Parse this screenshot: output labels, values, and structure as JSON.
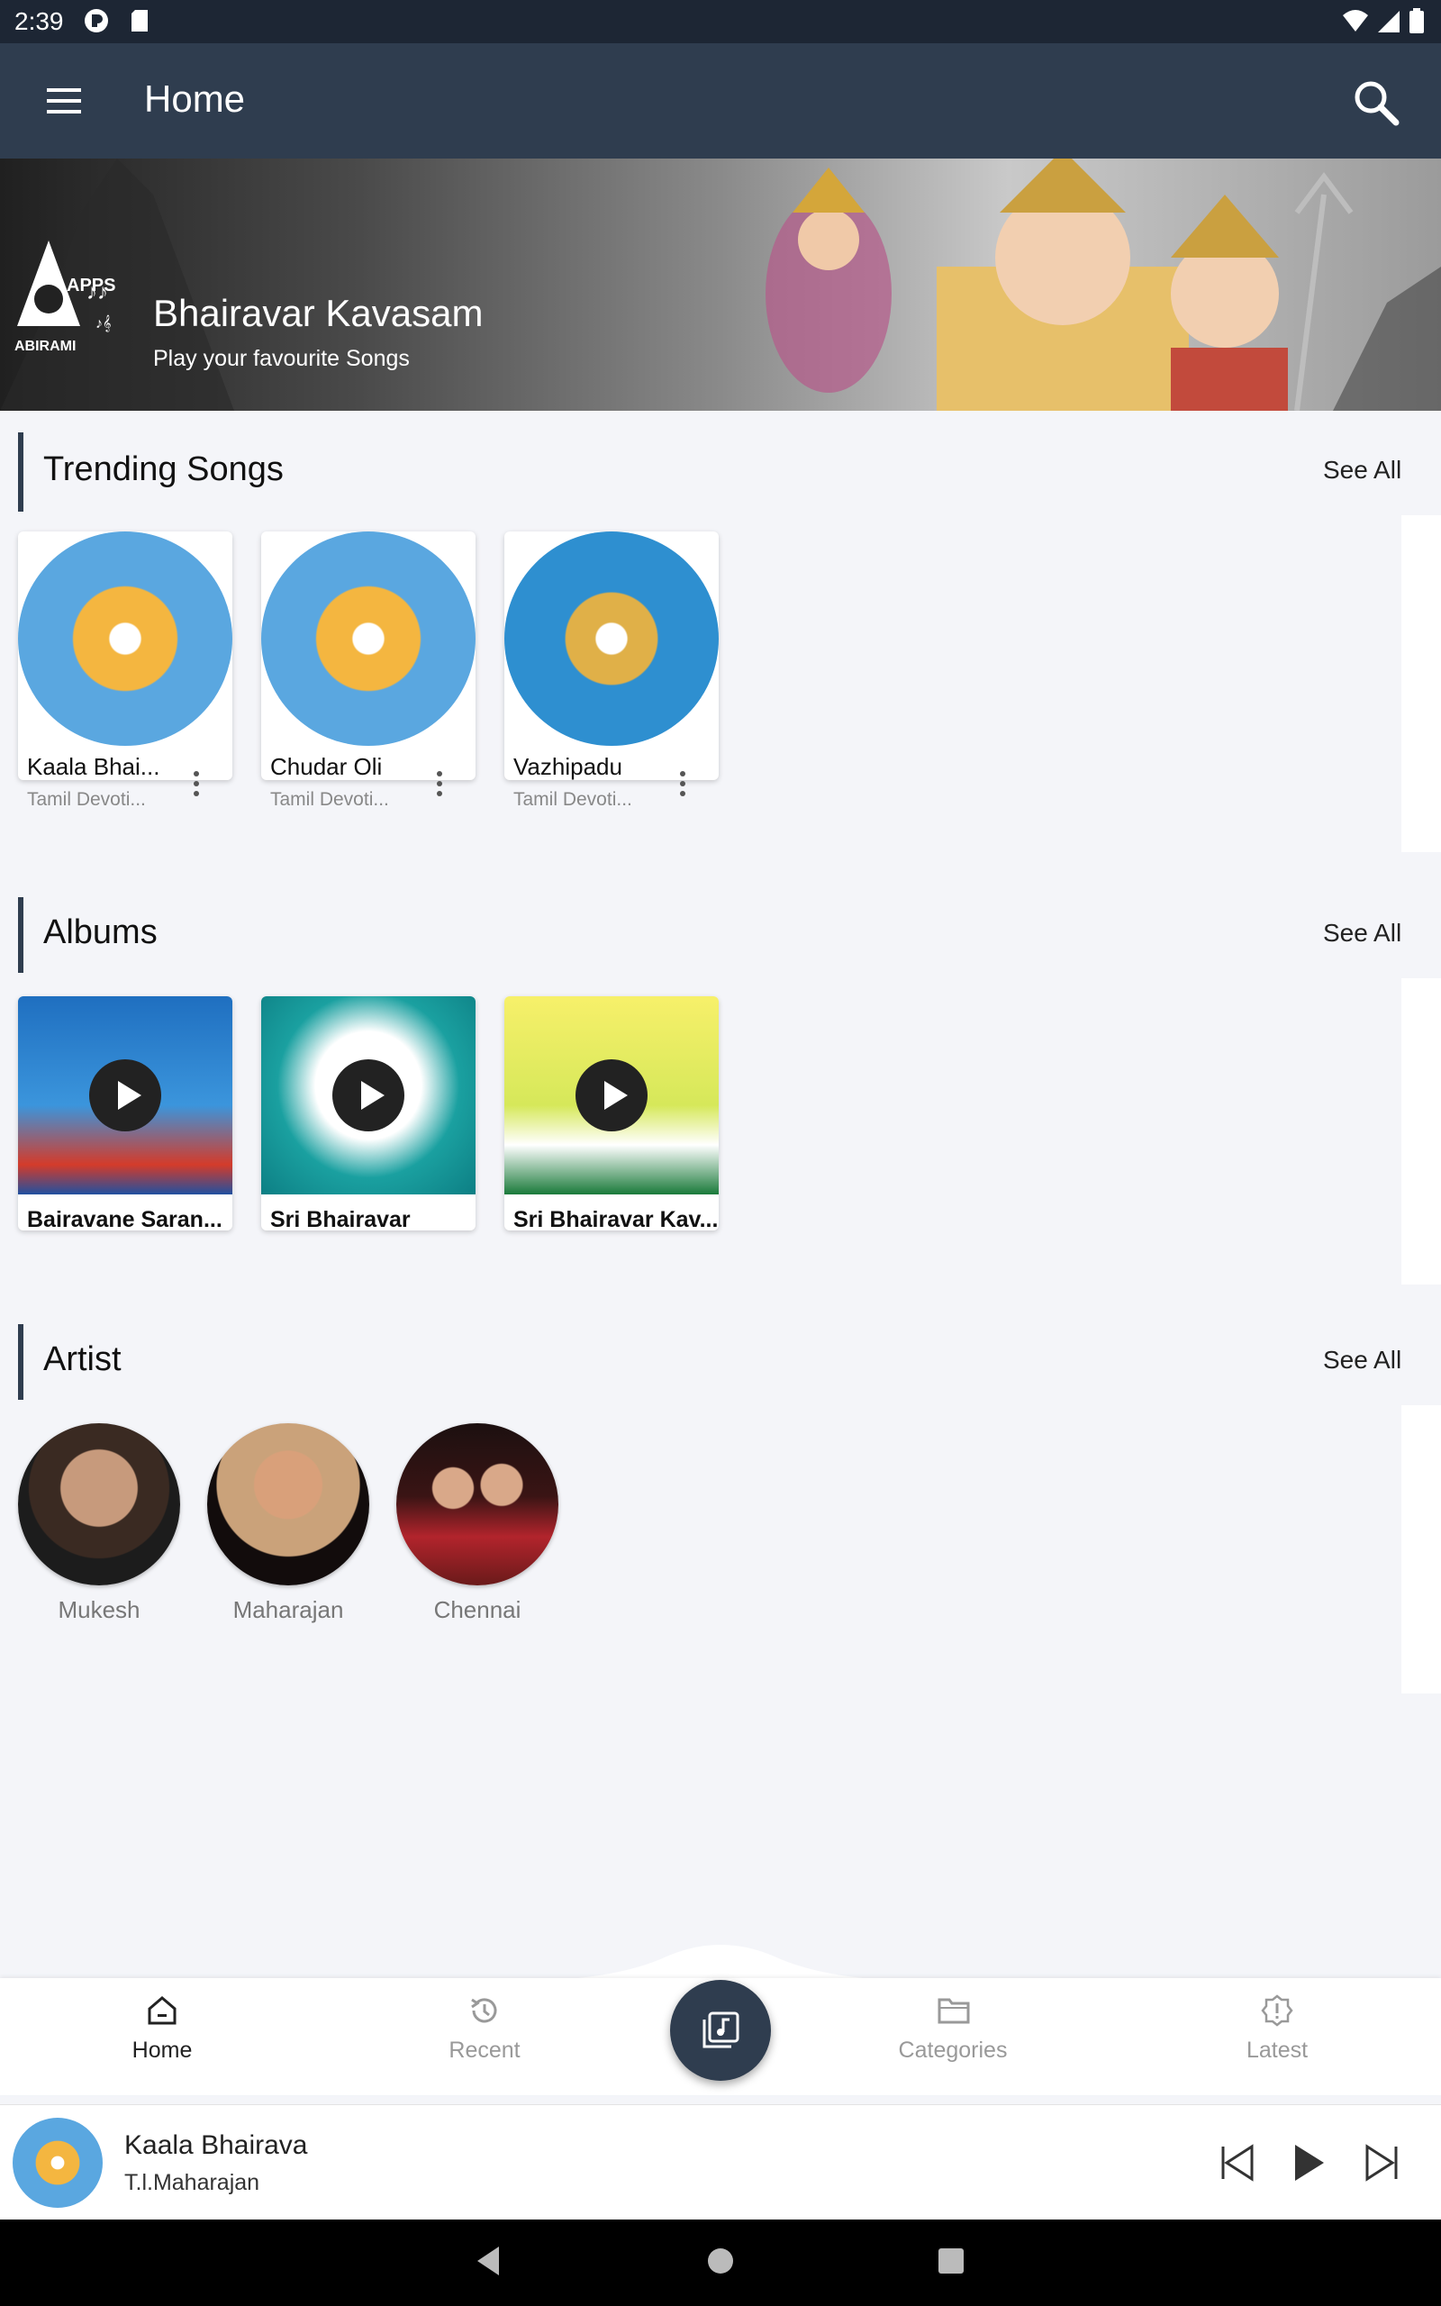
{
  "status_bar": {
    "time": "2:39"
  },
  "app_bar": {
    "title": "Home"
  },
  "banner": {
    "logo_text": "APPS",
    "logo_brand": "ABIRAMI",
    "title": "Bhairavar Kavasam",
    "subtitle": "Play your favourite Songs"
  },
  "trending": {
    "title": "Trending Songs",
    "see_all": "See All",
    "items": [
      {
        "title": "Kaala Bhai...",
        "subtitle": "Tamil Devoti..."
      },
      {
        "title": "Chudar Oli",
        "subtitle": "Tamil Devoti..."
      },
      {
        "title": "Vazhipadu",
        "subtitle": "Tamil Devoti..."
      }
    ]
  },
  "albums": {
    "title": "Albums",
    "see_all": "See All",
    "items": [
      {
        "title": "Bairavane Saran..."
      },
      {
        "title": "Sri Bhairavar"
      },
      {
        "title": "Sri Bhairavar Kav..."
      }
    ]
  },
  "artists": {
    "title": "Artist",
    "see_all": "See All",
    "items": [
      {
        "name": "Mukesh"
      },
      {
        "name": "Maharajan"
      },
      {
        "name": "Chennai"
      }
    ]
  },
  "bottom_nav": {
    "items": [
      {
        "label": "Home",
        "icon": "home-icon",
        "active": true
      },
      {
        "label": "Recent",
        "icon": "history-icon",
        "active": false
      },
      {
        "label": "Categories",
        "icon": "folder-icon",
        "active": false
      },
      {
        "label": "Latest",
        "icon": "alert-badge-icon",
        "active": false
      }
    ],
    "center_icon": "music-library-icon"
  },
  "now_playing": {
    "title": "Kaala Bhairava",
    "artist": "T.l.Maharajan"
  },
  "colors": {
    "app_bar": "#2f3d4f",
    "status_bar": "#1d2634",
    "accent": "#2f3d4f",
    "background": "#f4f5f9"
  }
}
